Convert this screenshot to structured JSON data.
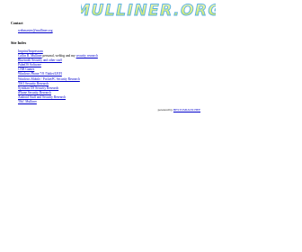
{
  "logo": {
    "text": "MULLINER.ORG"
  },
  "contact": {
    "heading": "Contact",
    "email": "webmaster@mulliner.org"
  },
  "site_index": {
    "heading": "Site Index",
    "items": [
      {
        "link": "Imprint/Impressum",
        "rest": ""
      },
      {
        "link": "Collin R. Mulliner",
        "rest": " personal, weblog and my",
        "link2": "security research"
      },
      {
        "link": "Bluetooth Security and other stuff",
        "rest": ""
      },
      {
        "link": "PalmOS Software",
        "rest": ""
      },
      {
        "link": "CNR Games",
        "rest": ""
      },
      {
        "link": "Windows Phone 7/8 /Tablet/UEFI",
        "rest": ""
      },
      {
        "link": "Windows Mobile / PocketPC Security Research",
        "rest": ""
      },
      {
        "link": "TAO Security Research",
        "rest": ""
      },
      {
        "link": "Symbian OS Security Research",
        "rest": ""
      },
      {
        "link": "iPhone Security Research",
        "rest": ""
      },
      {
        "link": "Android Stuff and Security Research",
        "rest": ""
      },
      {
        "link": "T&C Mulliner",
        "rest": ""
      }
    ]
  },
  "footer": {
    "powered_label": "powered by",
    "powered_link": "BESTUMIAVICHEF"
  }
}
